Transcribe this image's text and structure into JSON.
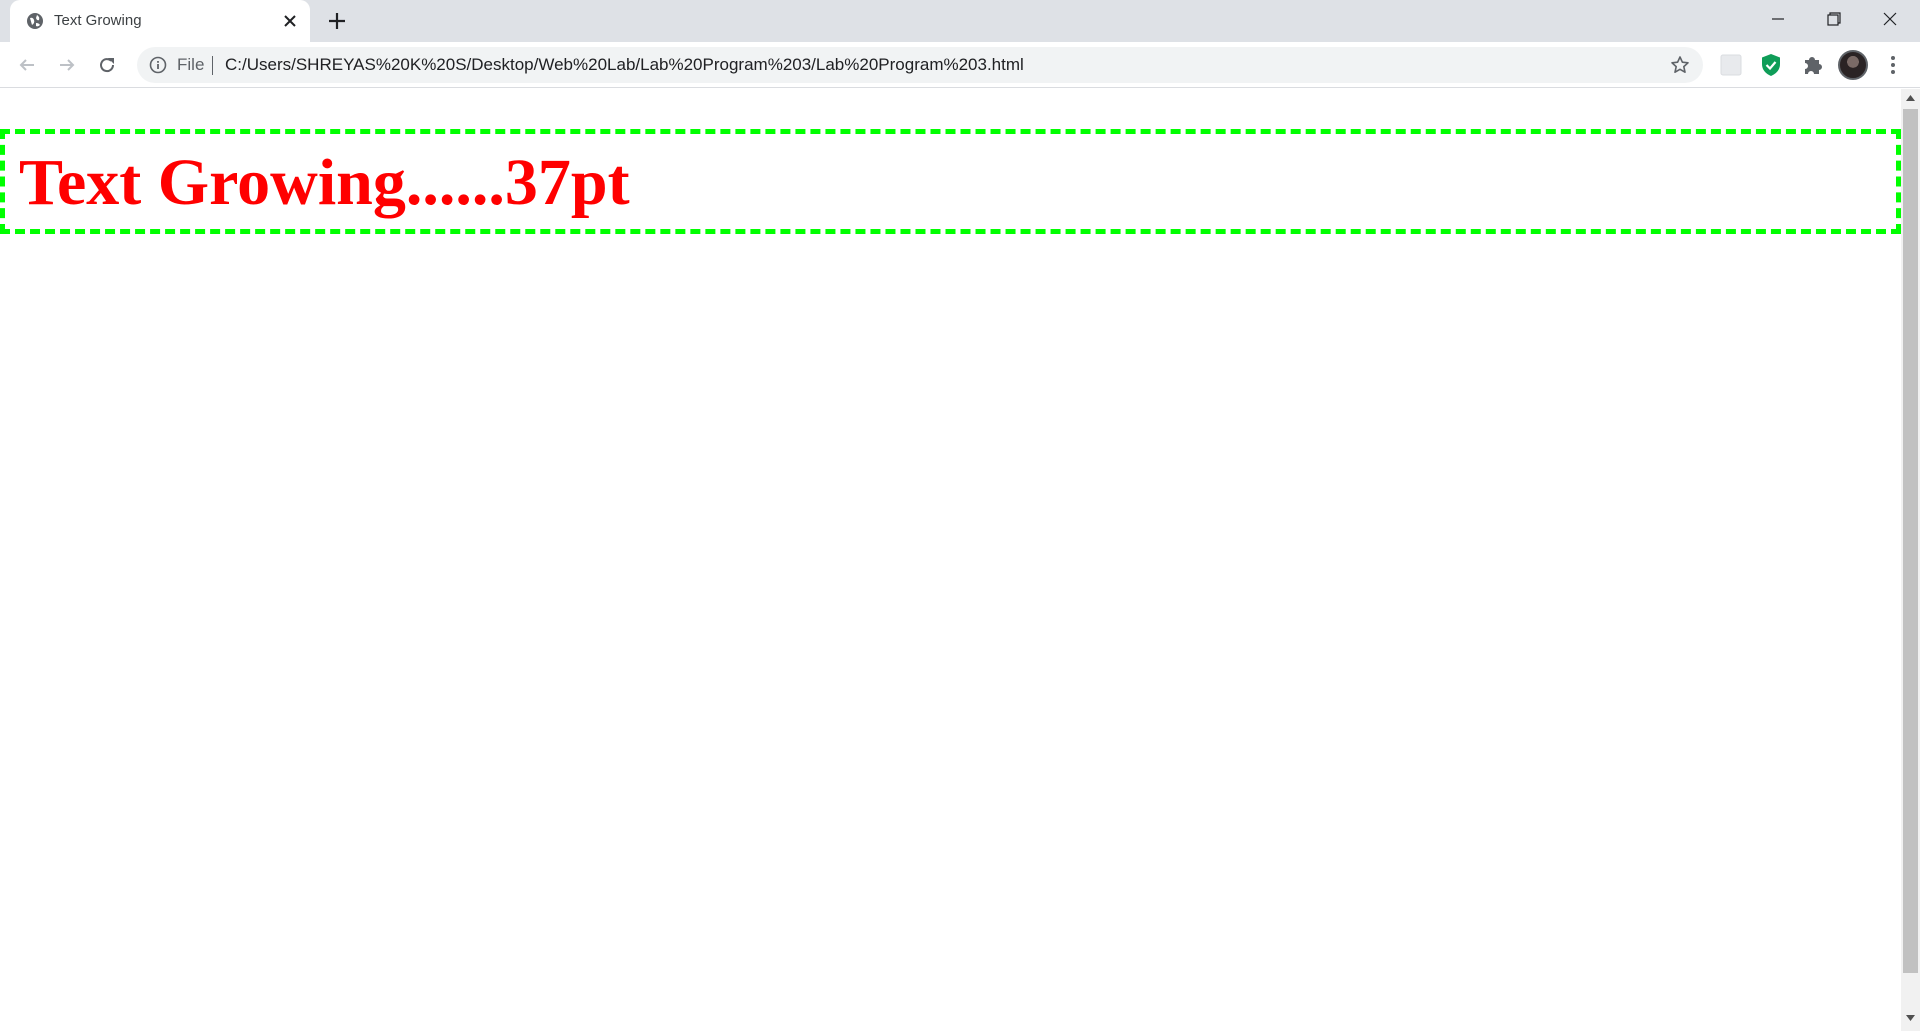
{
  "browser": {
    "tab": {
      "title": "Text Growing"
    },
    "address_bar": {
      "scheme_label": "File",
      "url": "C:/Users/SHREYAS%20K%20S/Desktop/Web%20Lab/Lab%20Program%203/Lab%20Program%203.html"
    },
    "colors": {
      "tabstrip": "#dee1e6",
      "omnibox": "#f1f3f4",
      "shield": "#0f9d58"
    },
    "icons": [
      "globe-icon",
      "close-icon",
      "plus-icon",
      "minimize-icon",
      "maximize-icon",
      "window-close-icon",
      "back-icon",
      "forward-icon",
      "reload-icon",
      "info-icon",
      "star-icon",
      "extension-icon",
      "shield-icon",
      "puzzle-icon",
      "avatar",
      "kebab-menu-icon"
    ]
  },
  "page": {
    "growing_text": "Text Growing......37pt",
    "text_color": "#ff0000",
    "border_color": "#00ff00"
  }
}
